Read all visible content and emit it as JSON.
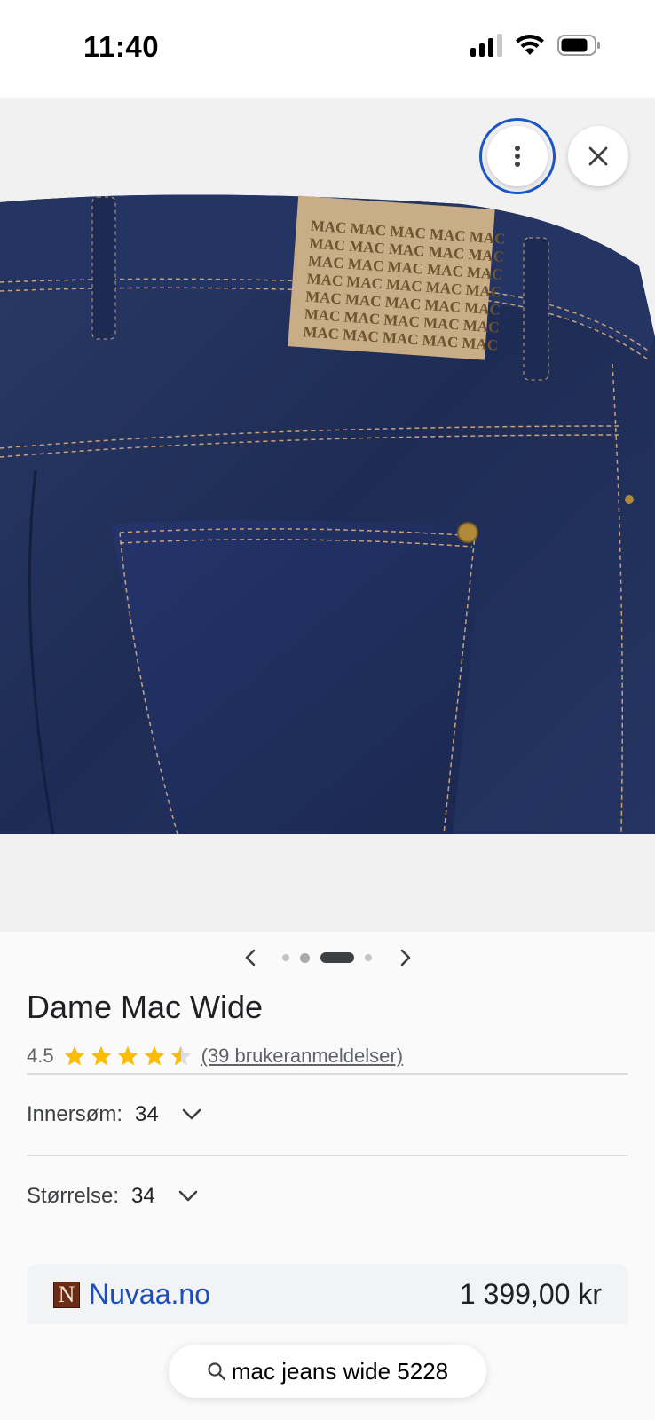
{
  "status_bar": {
    "time": "11:40",
    "icons": [
      "cellular-signal-icon",
      "wifi-icon",
      "battery-icon"
    ]
  },
  "product_viewer": {
    "image_description_icon": "product-image",
    "more_options_icon": "more-vertical-icon",
    "close_icon": "close-icon",
    "carousel": {
      "total_slides": 4,
      "active_slide": 3
    }
  },
  "product": {
    "title": "Dame Mac Wide",
    "rating": "4.5",
    "rating_value": 4.5,
    "rating_max": 5,
    "reviews_label": "(39 brukeranmeldelser)",
    "options": [
      {
        "label": "Innersøm:",
        "value": "34"
      },
      {
        "label": "Størrelse:",
        "value": "34"
      }
    ]
  },
  "merchant": {
    "logo_letter": "N",
    "name": "Nuvaa.no",
    "price": "1 399,00 kr"
  },
  "search": {
    "query": "mac jeans wide 5228"
  },
  "colors": {
    "accent_blue": "#1a56c8",
    "link_blue": "#1a4fba",
    "star_gold": "#fbbc04",
    "denim": "#1f2f56"
  }
}
